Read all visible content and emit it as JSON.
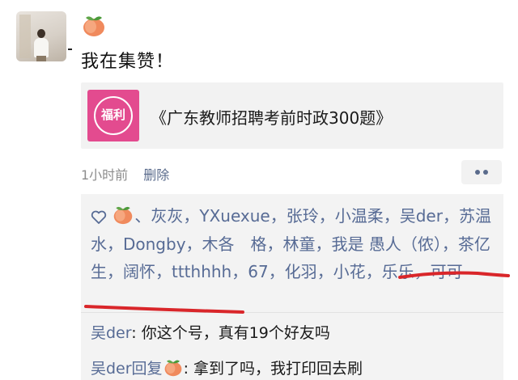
{
  "post": {
    "author_emoji": "peach-icon",
    "text": "我在集赞！",
    "link": {
      "thumb_text": "福利",
      "title": "《广东教师招聘考前时政300题》"
    },
    "time": "1小时前",
    "delete_label": "删除"
  },
  "likes": {
    "heart_icon": "heart-outline-icon",
    "names": [
      "、灰灰",
      "，YXuexue",
      "，张玲",
      "，小温柔",
      "，吴der",
      "，苏温水",
      "，Dongby",
      "，木各　格",
      "，林童",
      "，我是 愚人（侬）",
      "，茶亿生",
      "，阔怀",
      "，ttthhhh",
      "，67",
      "，化羽",
      "，小花",
      "，乐乐",
      "，可可"
    ]
  },
  "comments": [
    {
      "author": "吴der",
      "sep": ": ",
      "text": "你这个号，真有19个好友吗"
    },
    {
      "author": "吴der回复",
      "sep": ": ",
      "text": "拿到了吗，我打印回去刷"
    }
  ],
  "colors": {
    "link_blue": "#576b95",
    "annotation_red": "#d9262a",
    "thumb_pink": "#e34b8f"
  }
}
